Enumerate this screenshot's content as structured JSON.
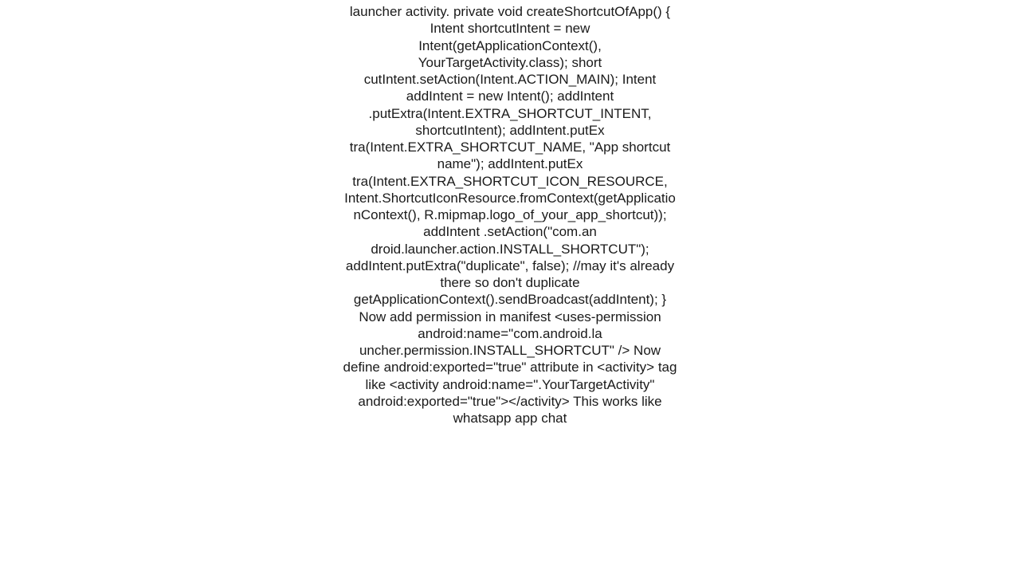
{
  "content": {
    "body": "launcher activity.      private void createShortcutOfApp() {           Intent shortcutIntent = new Intent(getApplicationContext(), YourTargetActivity.class);          short cutIntent.setAction(Intent.ACTION_MAIN);           Intent addIntent = new Intent();          addIntent             .putExtra(Intent.EXTRA_SHORTCUT_INTENT, shortcutIntent);          addIntent.putEx tra(Intent.EXTRA_SHORTCUT_NAME, \"App shortcut name\");          addIntent.putEx tra(Intent.EXTRA_SHORTCUT_ICON_RESOURCE,             Intent.ShortcutIconResource.fromContext(getApplicationContext(),                 R.mipmap.logo_of_your_app_shortcut));           addIntent             .setAction(\"com.an droid.launcher.action.INSTALL_SHORTCUT\");          addIntent.putExtra(\"duplicate\", false);  //may it's already there so   don't duplicate          getApplicationContext().sendBroadcast(addIntent);      }  Now add permission in manifest <uses-permission  android:name=\"com.android.la uncher.permission.INSTALL_SHORTCUT\" />    Now define  android:exported=\"true\"  attribute in  <activity> tag   like  <activity   android:name=\".YourTargetActivity\"   android:exported=\"true\"></activity>  This works like whatsapp app chat"
  }
}
